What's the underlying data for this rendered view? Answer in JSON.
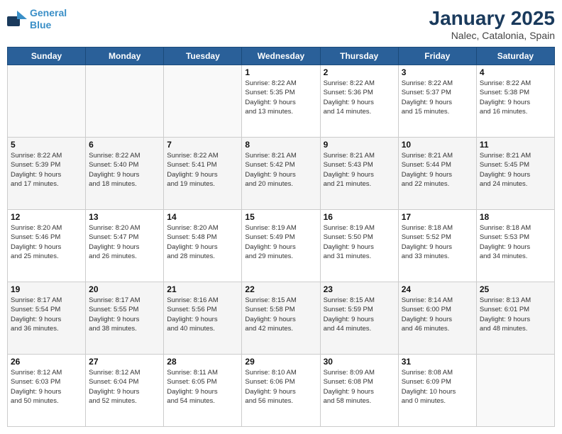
{
  "logo": {
    "line1": "General",
    "line2": "Blue"
  },
  "title": "January 2025",
  "subtitle": "Nalec, Catalonia, Spain",
  "weekdays": [
    "Sunday",
    "Monday",
    "Tuesday",
    "Wednesday",
    "Thursday",
    "Friday",
    "Saturday"
  ],
  "weeks": [
    [
      {
        "day": "",
        "info": ""
      },
      {
        "day": "",
        "info": ""
      },
      {
        "day": "",
        "info": ""
      },
      {
        "day": "1",
        "info": "Sunrise: 8:22 AM\nSunset: 5:35 PM\nDaylight: 9 hours\nand 13 minutes."
      },
      {
        "day": "2",
        "info": "Sunrise: 8:22 AM\nSunset: 5:36 PM\nDaylight: 9 hours\nand 14 minutes."
      },
      {
        "day": "3",
        "info": "Sunrise: 8:22 AM\nSunset: 5:37 PM\nDaylight: 9 hours\nand 15 minutes."
      },
      {
        "day": "4",
        "info": "Sunrise: 8:22 AM\nSunset: 5:38 PM\nDaylight: 9 hours\nand 16 minutes."
      }
    ],
    [
      {
        "day": "5",
        "info": "Sunrise: 8:22 AM\nSunset: 5:39 PM\nDaylight: 9 hours\nand 17 minutes."
      },
      {
        "day": "6",
        "info": "Sunrise: 8:22 AM\nSunset: 5:40 PM\nDaylight: 9 hours\nand 18 minutes."
      },
      {
        "day": "7",
        "info": "Sunrise: 8:22 AM\nSunset: 5:41 PM\nDaylight: 9 hours\nand 19 minutes."
      },
      {
        "day": "8",
        "info": "Sunrise: 8:21 AM\nSunset: 5:42 PM\nDaylight: 9 hours\nand 20 minutes."
      },
      {
        "day": "9",
        "info": "Sunrise: 8:21 AM\nSunset: 5:43 PM\nDaylight: 9 hours\nand 21 minutes."
      },
      {
        "day": "10",
        "info": "Sunrise: 8:21 AM\nSunset: 5:44 PM\nDaylight: 9 hours\nand 22 minutes."
      },
      {
        "day": "11",
        "info": "Sunrise: 8:21 AM\nSunset: 5:45 PM\nDaylight: 9 hours\nand 24 minutes."
      }
    ],
    [
      {
        "day": "12",
        "info": "Sunrise: 8:20 AM\nSunset: 5:46 PM\nDaylight: 9 hours\nand 25 minutes."
      },
      {
        "day": "13",
        "info": "Sunrise: 8:20 AM\nSunset: 5:47 PM\nDaylight: 9 hours\nand 26 minutes."
      },
      {
        "day": "14",
        "info": "Sunrise: 8:20 AM\nSunset: 5:48 PM\nDaylight: 9 hours\nand 28 minutes."
      },
      {
        "day": "15",
        "info": "Sunrise: 8:19 AM\nSunset: 5:49 PM\nDaylight: 9 hours\nand 29 minutes."
      },
      {
        "day": "16",
        "info": "Sunrise: 8:19 AM\nSunset: 5:50 PM\nDaylight: 9 hours\nand 31 minutes."
      },
      {
        "day": "17",
        "info": "Sunrise: 8:18 AM\nSunset: 5:52 PM\nDaylight: 9 hours\nand 33 minutes."
      },
      {
        "day": "18",
        "info": "Sunrise: 8:18 AM\nSunset: 5:53 PM\nDaylight: 9 hours\nand 34 minutes."
      }
    ],
    [
      {
        "day": "19",
        "info": "Sunrise: 8:17 AM\nSunset: 5:54 PM\nDaylight: 9 hours\nand 36 minutes."
      },
      {
        "day": "20",
        "info": "Sunrise: 8:17 AM\nSunset: 5:55 PM\nDaylight: 9 hours\nand 38 minutes."
      },
      {
        "day": "21",
        "info": "Sunrise: 8:16 AM\nSunset: 5:56 PM\nDaylight: 9 hours\nand 40 minutes."
      },
      {
        "day": "22",
        "info": "Sunrise: 8:15 AM\nSunset: 5:58 PM\nDaylight: 9 hours\nand 42 minutes."
      },
      {
        "day": "23",
        "info": "Sunrise: 8:15 AM\nSunset: 5:59 PM\nDaylight: 9 hours\nand 44 minutes."
      },
      {
        "day": "24",
        "info": "Sunrise: 8:14 AM\nSunset: 6:00 PM\nDaylight: 9 hours\nand 46 minutes."
      },
      {
        "day": "25",
        "info": "Sunrise: 8:13 AM\nSunset: 6:01 PM\nDaylight: 9 hours\nand 48 minutes."
      }
    ],
    [
      {
        "day": "26",
        "info": "Sunrise: 8:12 AM\nSunset: 6:03 PM\nDaylight: 9 hours\nand 50 minutes."
      },
      {
        "day": "27",
        "info": "Sunrise: 8:12 AM\nSunset: 6:04 PM\nDaylight: 9 hours\nand 52 minutes."
      },
      {
        "day": "28",
        "info": "Sunrise: 8:11 AM\nSunset: 6:05 PM\nDaylight: 9 hours\nand 54 minutes."
      },
      {
        "day": "29",
        "info": "Sunrise: 8:10 AM\nSunset: 6:06 PM\nDaylight: 9 hours\nand 56 minutes."
      },
      {
        "day": "30",
        "info": "Sunrise: 8:09 AM\nSunset: 6:08 PM\nDaylight: 9 hours\nand 58 minutes."
      },
      {
        "day": "31",
        "info": "Sunrise: 8:08 AM\nSunset: 6:09 PM\nDaylight: 10 hours\nand 0 minutes."
      },
      {
        "day": "",
        "info": ""
      }
    ]
  ]
}
